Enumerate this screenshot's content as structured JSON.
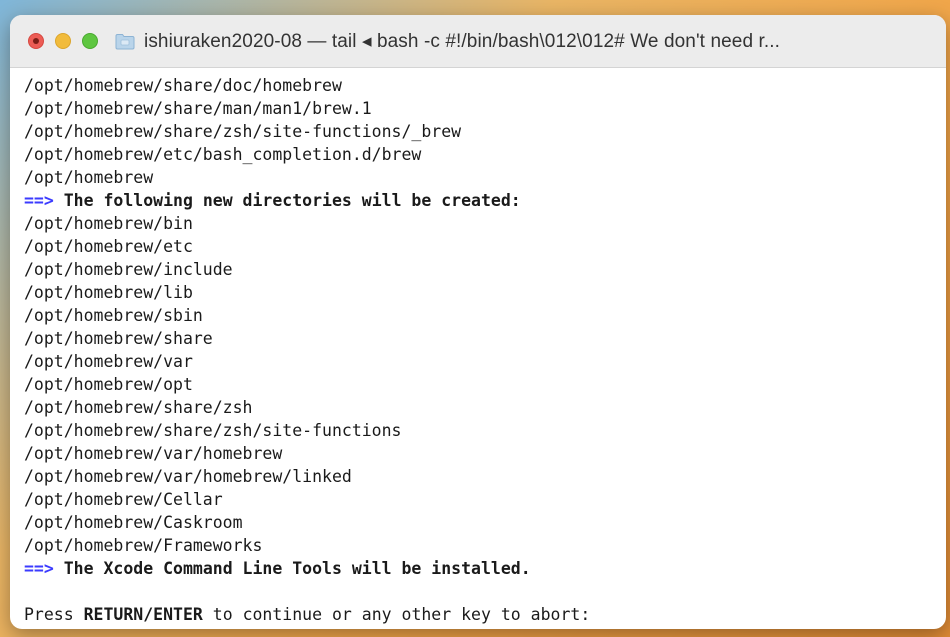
{
  "window": {
    "title": "ishiuraken2020-08 — tail ◂ bash -c #!/bin/bash\\012\\012# We don't need r..."
  },
  "colors": {
    "close": "#ec5c55",
    "minimize": "#f1bb3c",
    "zoom": "#5ec640",
    "arrow": "#3b3bff"
  },
  "terminal": {
    "lines": [
      {
        "type": "path",
        "text": "/opt/homebrew/share/doc/homebrew"
      },
      {
        "type": "path",
        "text": "/opt/homebrew/share/man/man1/brew.1"
      },
      {
        "type": "path",
        "text": "/opt/homebrew/share/zsh/site-functions/_brew"
      },
      {
        "type": "path",
        "text": "/opt/homebrew/etc/bash_completion.d/brew"
      },
      {
        "type": "path",
        "text": "/opt/homebrew"
      },
      {
        "type": "heading",
        "arrow": "==>",
        "text": " The following new directories will be created:"
      },
      {
        "type": "path",
        "text": "/opt/homebrew/bin"
      },
      {
        "type": "path",
        "text": "/opt/homebrew/etc"
      },
      {
        "type": "path",
        "text": "/opt/homebrew/include"
      },
      {
        "type": "path",
        "text": "/opt/homebrew/lib"
      },
      {
        "type": "path",
        "text": "/opt/homebrew/sbin"
      },
      {
        "type": "path",
        "text": "/opt/homebrew/share"
      },
      {
        "type": "path",
        "text": "/opt/homebrew/var"
      },
      {
        "type": "path",
        "text": "/opt/homebrew/opt"
      },
      {
        "type": "path",
        "text": "/opt/homebrew/share/zsh"
      },
      {
        "type": "path",
        "text": "/opt/homebrew/share/zsh/site-functions"
      },
      {
        "type": "path",
        "text": "/opt/homebrew/var/homebrew"
      },
      {
        "type": "path",
        "text": "/opt/homebrew/var/homebrew/linked"
      },
      {
        "type": "path",
        "text": "/opt/homebrew/Cellar"
      },
      {
        "type": "path",
        "text": "/opt/homebrew/Caskroom"
      },
      {
        "type": "path",
        "text": "/opt/homebrew/Frameworks"
      },
      {
        "type": "heading",
        "arrow": "==>",
        "text": " The Xcode Command Line Tools will be installed."
      },
      {
        "type": "blank",
        "text": ""
      }
    ],
    "prompt": {
      "prefix": "Press ",
      "key1": "RETURN",
      "sep": "/",
      "key2": "ENTER",
      "suffix": " to continue or any other key to abort:"
    }
  }
}
